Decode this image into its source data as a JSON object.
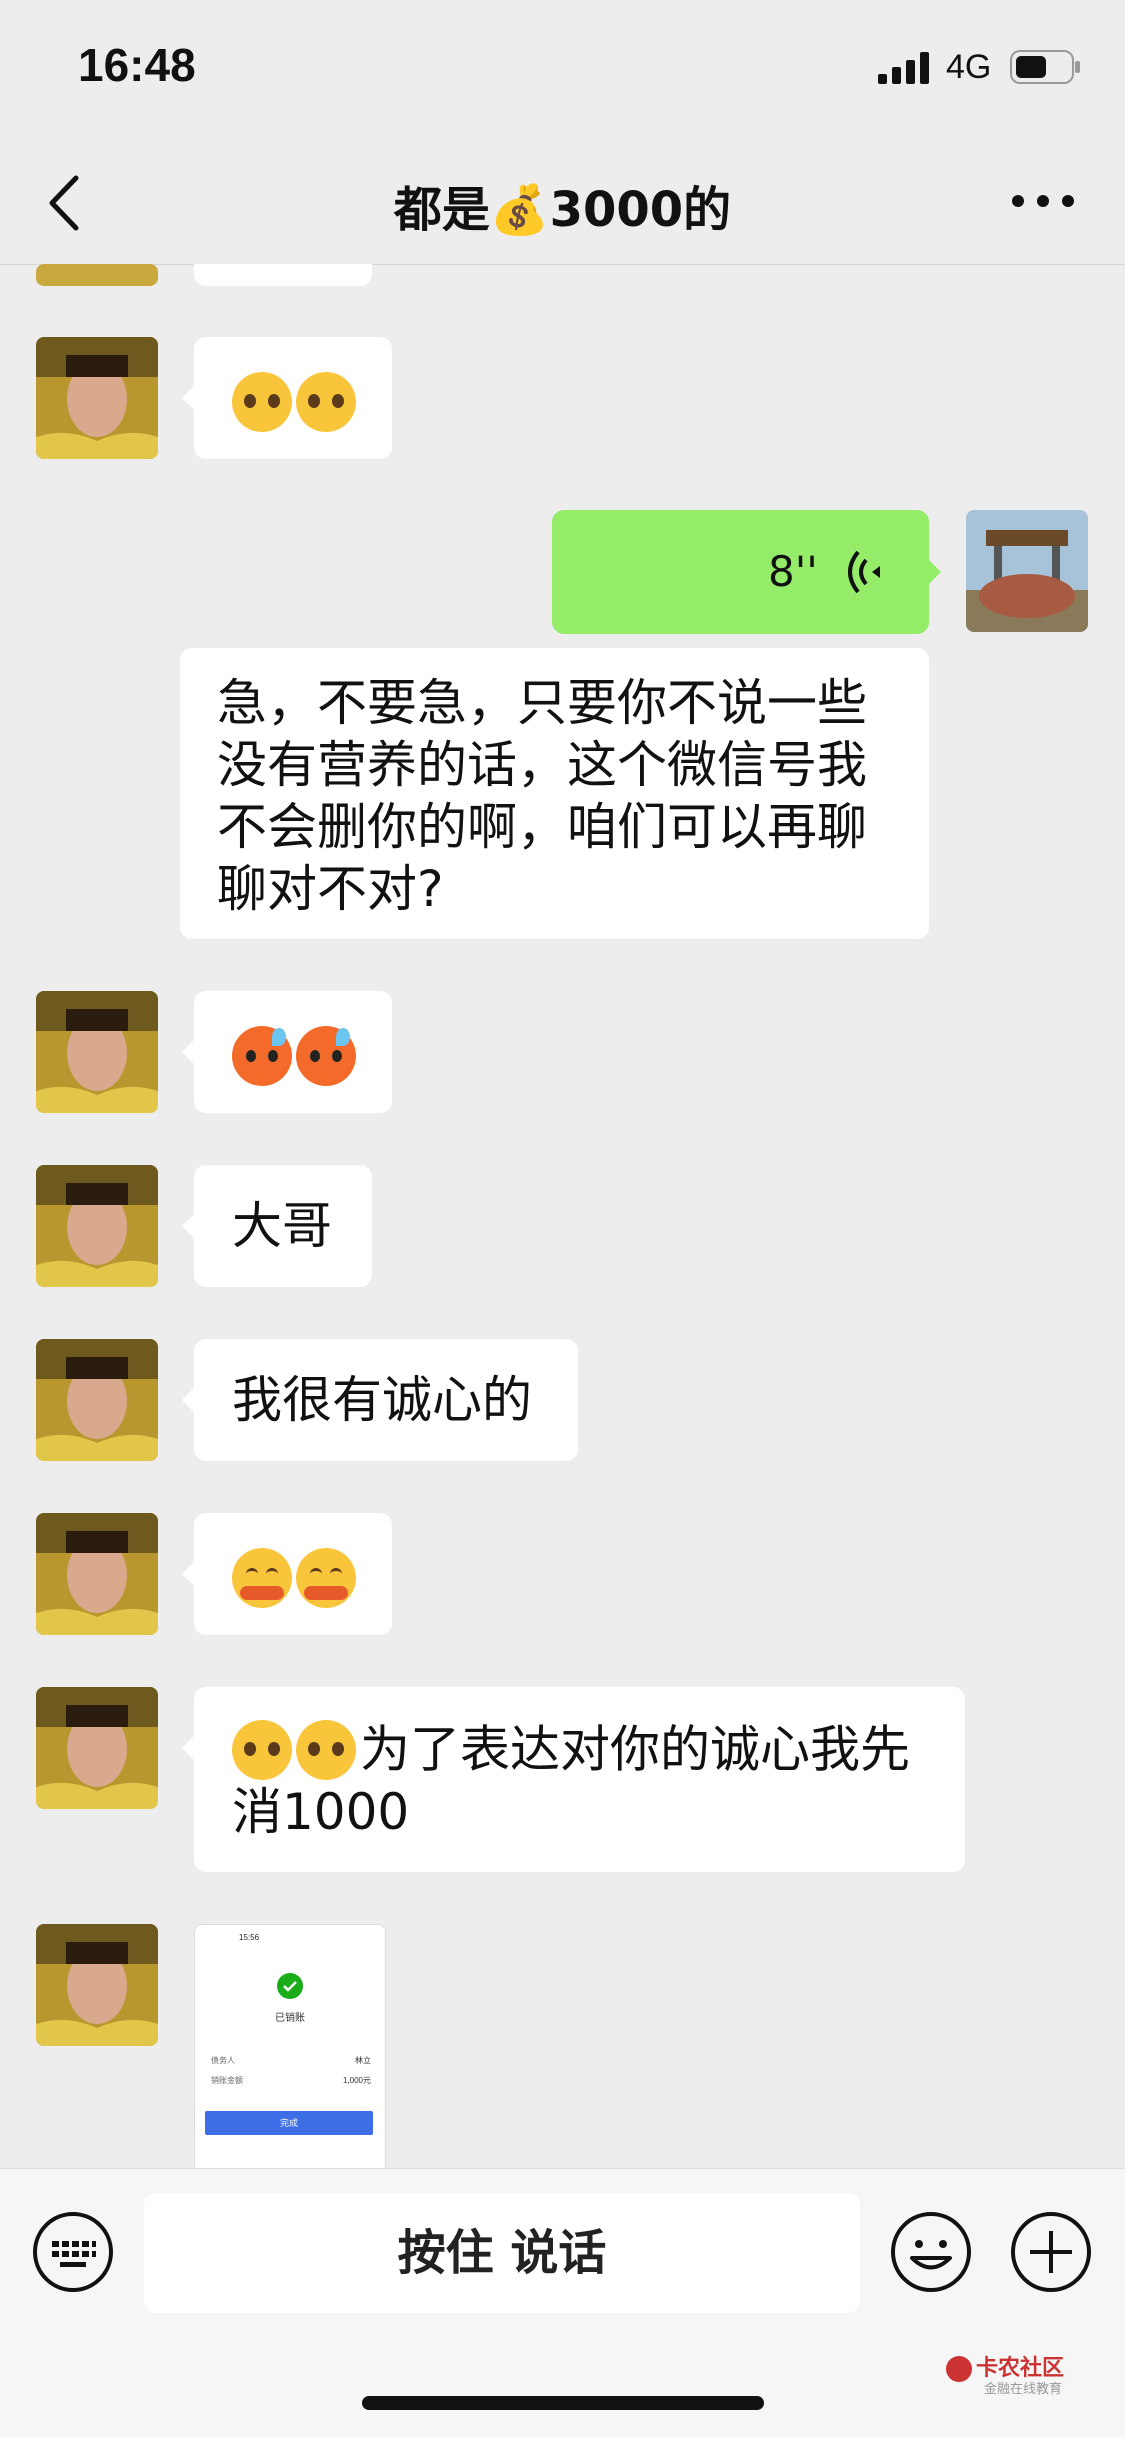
{
  "status": {
    "time": "16:48",
    "network": "4G"
  },
  "header": {
    "title": "都是💰3000的"
  },
  "messages": {
    "voice_duration": "8''",
    "long_text": [
      "急，不要急，只要你不说一些",
      "没有营养的话，这个微信号我",
      "不会删你的啊，咱们可以再聊",
      "聊对不对?"
    ],
    "m_dage": "大哥",
    "m_sincere": "我很有诚心的",
    "m_show": "为了表达对你的诚心我先",
    "m_show2": "消1000"
  },
  "receipt": {
    "time": "15:56",
    "status": "已销账",
    "row1_label": "债务人",
    "row1_value": "林立",
    "row2_label": "销账金额",
    "row2_value": "1,000元",
    "button": "完成"
  },
  "input": {
    "voice_label": "按住 说话"
  },
  "watermark": {
    "name": "卡农社区",
    "sub": "金融在线教育"
  }
}
